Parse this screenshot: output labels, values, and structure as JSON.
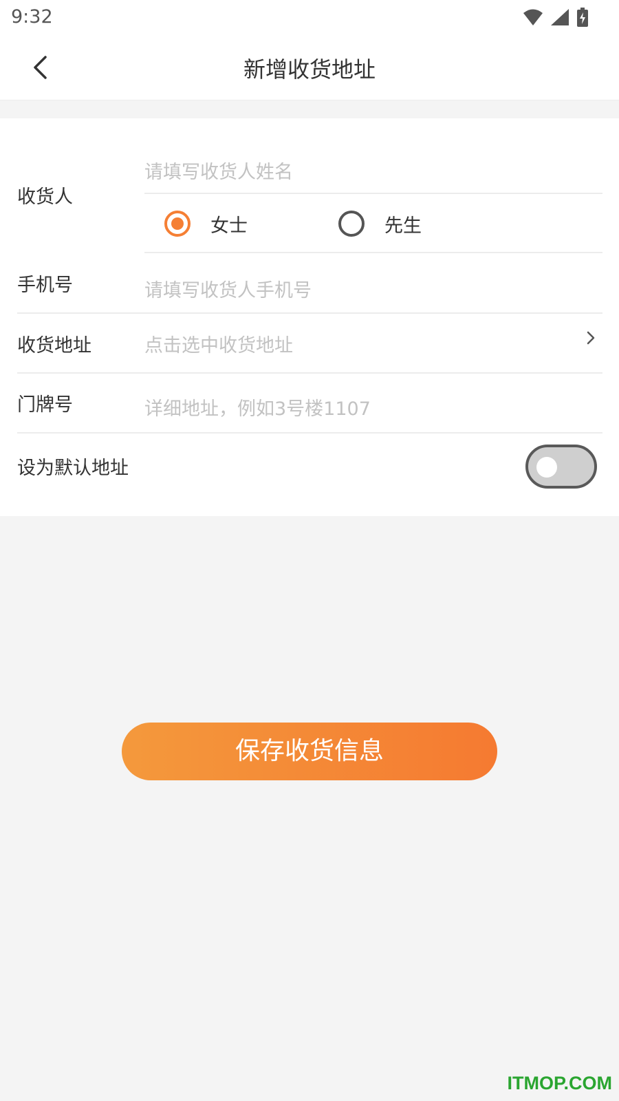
{
  "status_bar": {
    "time": "9:32",
    "icons": [
      "wifi-icon",
      "signal-icon",
      "battery-charging-icon"
    ]
  },
  "app_bar": {
    "title": "新增收货地址",
    "back_icon": "chevron-left-icon"
  },
  "form": {
    "receiver": {
      "label": "收货人",
      "placeholder": "请填写收货人姓名",
      "gender_options": [
        {
          "label": "女士",
          "selected": true
        },
        {
          "label": "先生",
          "selected": false
        }
      ]
    },
    "phone": {
      "label": "手机号",
      "placeholder": "请填写收货人手机号"
    },
    "address": {
      "label": "收货地址",
      "placeholder": "点击选中收货地址",
      "icon": "chevron-right-icon"
    },
    "door_number": {
      "label": "门牌号",
      "placeholder": "详细地址，例如3号楼1107"
    },
    "default_address": {
      "label": "设为默认地址",
      "enabled": false
    }
  },
  "save_button": {
    "label": "保存收货信息"
  },
  "watermark": "ITMOP.COM",
  "colors": {
    "accent": "#f57f34",
    "button_start": "#f4993c",
    "button_end": "#f57a31",
    "background": "#f4f4f4",
    "watermark": "#2aa530"
  }
}
